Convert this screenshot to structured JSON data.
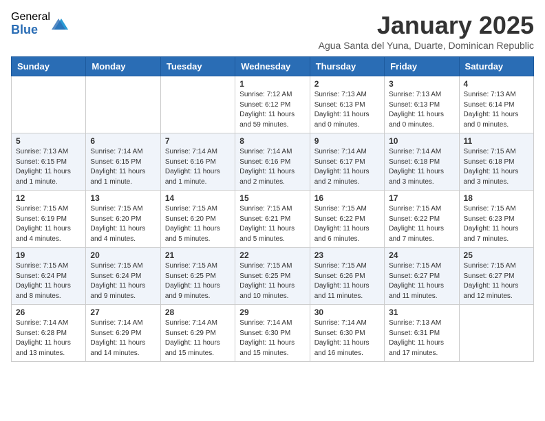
{
  "logo": {
    "general": "General",
    "blue": "Blue"
  },
  "title": "January 2025",
  "subtitle": "Agua Santa del Yuna, Duarte, Dominican Republic",
  "days_of_week": [
    "Sunday",
    "Monday",
    "Tuesday",
    "Wednesday",
    "Thursday",
    "Friday",
    "Saturday"
  ],
  "weeks": [
    [
      {
        "day": "",
        "info": ""
      },
      {
        "day": "",
        "info": ""
      },
      {
        "day": "",
        "info": ""
      },
      {
        "day": "1",
        "info": "Sunrise: 7:12 AM\nSunset: 6:12 PM\nDaylight: 11 hours and 59 minutes."
      },
      {
        "day": "2",
        "info": "Sunrise: 7:13 AM\nSunset: 6:13 PM\nDaylight: 11 hours and 0 minutes."
      },
      {
        "day": "3",
        "info": "Sunrise: 7:13 AM\nSunset: 6:13 PM\nDaylight: 11 hours and 0 minutes."
      },
      {
        "day": "4",
        "info": "Sunrise: 7:13 AM\nSunset: 6:14 PM\nDaylight: 11 hours and 0 minutes."
      }
    ],
    [
      {
        "day": "5",
        "info": "Sunrise: 7:13 AM\nSunset: 6:15 PM\nDaylight: 11 hours and 1 minute."
      },
      {
        "day": "6",
        "info": "Sunrise: 7:14 AM\nSunset: 6:15 PM\nDaylight: 11 hours and 1 minute."
      },
      {
        "day": "7",
        "info": "Sunrise: 7:14 AM\nSunset: 6:16 PM\nDaylight: 11 hours and 1 minute."
      },
      {
        "day": "8",
        "info": "Sunrise: 7:14 AM\nSunset: 6:16 PM\nDaylight: 11 hours and 2 minutes."
      },
      {
        "day": "9",
        "info": "Sunrise: 7:14 AM\nSunset: 6:17 PM\nDaylight: 11 hours and 2 minutes."
      },
      {
        "day": "10",
        "info": "Sunrise: 7:14 AM\nSunset: 6:18 PM\nDaylight: 11 hours and 3 minutes."
      },
      {
        "day": "11",
        "info": "Sunrise: 7:15 AM\nSunset: 6:18 PM\nDaylight: 11 hours and 3 minutes."
      }
    ],
    [
      {
        "day": "12",
        "info": "Sunrise: 7:15 AM\nSunset: 6:19 PM\nDaylight: 11 hours and 4 minutes."
      },
      {
        "day": "13",
        "info": "Sunrise: 7:15 AM\nSunset: 6:20 PM\nDaylight: 11 hours and 4 minutes."
      },
      {
        "day": "14",
        "info": "Sunrise: 7:15 AM\nSunset: 6:20 PM\nDaylight: 11 hours and 5 minutes."
      },
      {
        "day": "15",
        "info": "Sunrise: 7:15 AM\nSunset: 6:21 PM\nDaylight: 11 hours and 5 minutes."
      },
      {
        "day": "16",
        "info": "Sunrise: 7:15 AM\nSunset: 6:22 PM\nDaylight: 11 hours and 6 minutes."
      },
      {
        "day": "17",
        "info": "Sunrise: 7:15 AM\nSunset: 6:22 PM\nDaylight: 11 hours and 7 minutes."
      },
      {
        "day": "18",
        "info": "Sunrise: 7:15 AM\nSunset: 6:23 PM\nDaylight: 11 hours and 7 minutes."
      }
    ],
    [
      {
        "day": "19",
        "info": "Sunrise: 7:15 AM\nSunset: 6:24 PM\nDaylight: 11 hours and 8 minutes."
      },
      {
        "day": "20",
        "info": "Sunrise: 7:15 AM\nSunset: 6:24 PM\nDaylight: 11 hours and 9 minutes."
      },
      {
        "day": "21",
        "info": "Sunrise: 7:15 AM\nSunset: 6:25 PM\nDaylight: 11 hours and 9 minutes."
      },
      {
        "day": "22",
        "info": "Sunrise: 7:15 AM\nSunset: 6:25 PM\nDaylight: 11 hours and 10 minutes."
      },
      {
        "day": "23",
        "info": "Sunrise: 7:15 AM\nSunset: 6:26 PM\nDaylight: 11 hours and 11 minutes."
      },
      {
        "day": "24",
        "info": "Sunrise: 7:15 AM\nSunset: 6:27 PM\nDaylight: 11 hours and 11 minutes."
      },
      {
        "day": "25",
        "info": "Sunrise: 7:15 AM\nSunset: 6:27 PM\nDaylight: 11 hours and 12 minutes."
      }
    ],
    [
      {
        "day": "26",
        "info": "Sunrise: 7:14 AM\nSunset: 6:28 PM\nDaylight: 11 hours and 13 minutes."
      },
      {
        "day": "27",
        "info": "Sunrise: 7:14 AM\nSunset: 6:29 PM\nDaylight: 11 hours and 14 minutes."
      },
      {
        "day": "28",
        "info": "Sunrise: 7:14 AM\nSunset: 6:29 PM\nDaylight: 11 hours and 15 minutes."
      },
      {
        "day": "29",
        "info": "Sunrise: 7:14 AM\nSunset: 6:30 PM\nDaylight: 11 hours and 15 minutes."
      },
      {
        "day": "30",
        "info": "Sunrise: 7:14 AM\nSunset: 6:30 PM\nDaylight: 11 hours and 16 minutes."
      },
      {
        "day": "31",
        "info": "Sunrise: 7:13 AM\nSunset: 6:31 PM\nDaylight: 11 hours and 17 minutes."
      },
      {
        "day": "",
        "info": ""
      }
    ]
  ]
}
